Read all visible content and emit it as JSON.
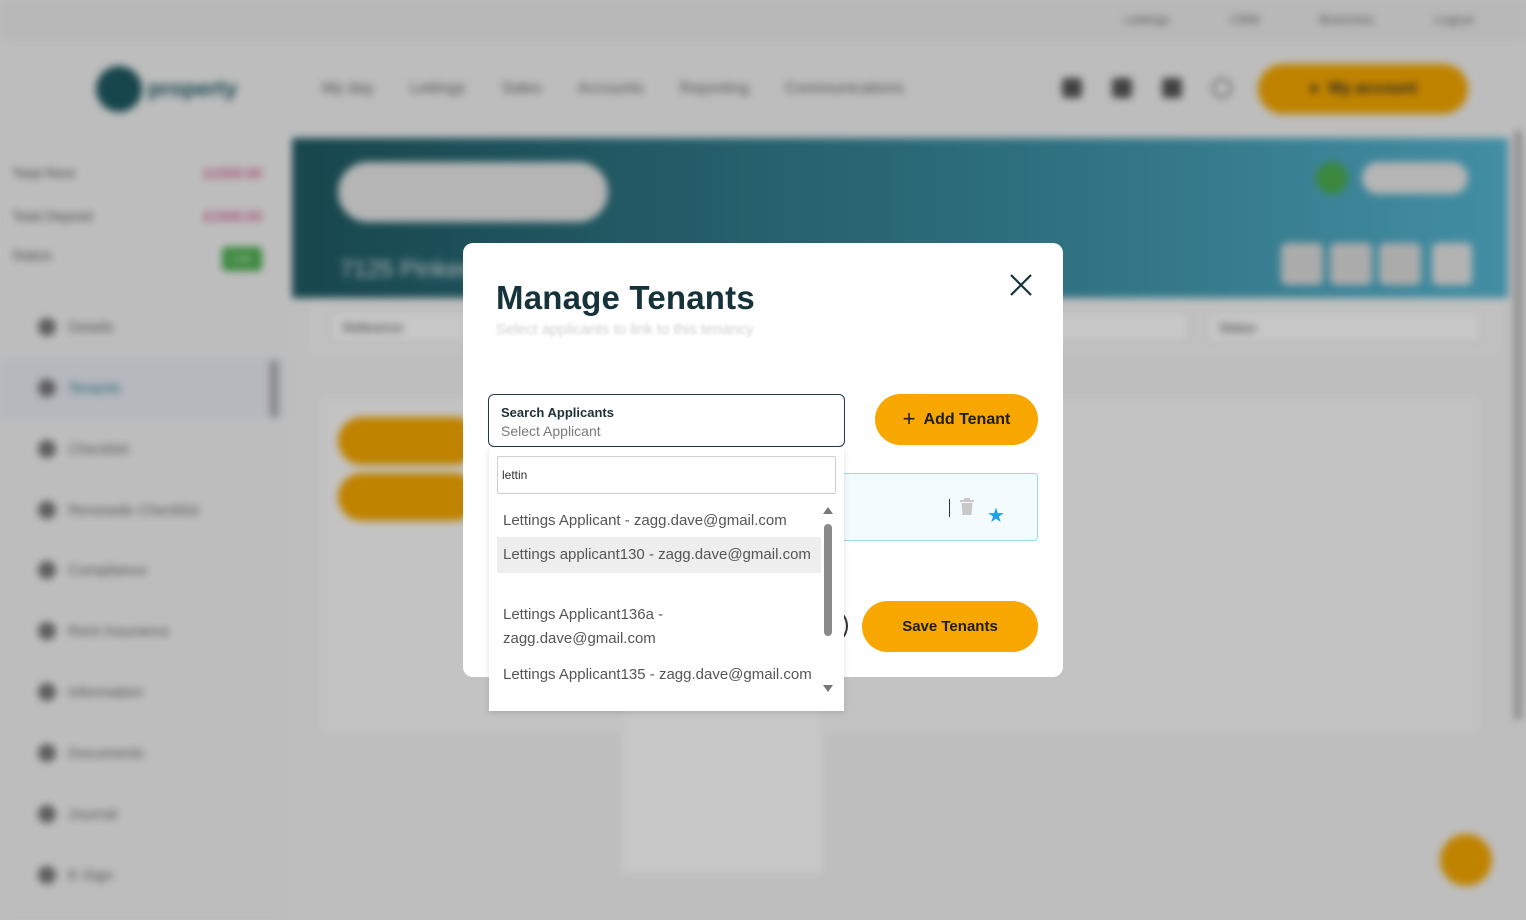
{
  "background": {
    "top_links": [
      "Lettings",
      "CRM",
      "Branches",
      "Logout"
    ],
    "logo_text": "property",
    "menu": [
      "My day",
      "Lettings",
      "Sales",
      "Accounts",
      "Reporting",
      "Communications"
    ],
    "account_label": "My account",
    "stats": [
      {
        "label": "Total Rent",
        "value": "£1500.00"
      },
      {
        "label": "Total Deposit",
        "value": "£1500.00"
      },
      {
        "label": "Status",
        "value": "Live"
      }
    ],
    "sidebar": [
      "Details",
      "Tenants",
      "Checklist",
      "Renewals Checklist",
      "Compliance",
      "Rent Insurance",
      "Information",
      "Documents",
      "Journal",
      "E-Sign"
    ],
    "hero_title": "7125 Pinkee",
    "filter_label": "Reference",
    "status_filter": "Status"
  },
  "modal": {
    "title": "Manage Tenants",
    "subtitle": "Select applicants to link to this tenancy",
    "search": {
      "label": "Search Applicants",
      "placeholder": "Select Applicant"
    },
    "add_button": "Add Tenant",
    "save_button": "Save Tenants"
  },
  "dropdown": {
    "query": "lettin",
    "options": [
      "Lettings Applicant - zagg.dave@gmail.com",
      "Lettings applicant130 - zagg.dave@gmail.com",
      "Lettings Applicant136a - zagg.dave@gmail.com",
      "Lettings Applicant135 - zagg.dave@gmail.com"
    ],
    "highlighted_index": 1
  },
  "colors": {
    "accent": "#f7a700",
    "brand_dark": "#1f5a63",
    "star": "#1aa3e8"
  }
}
